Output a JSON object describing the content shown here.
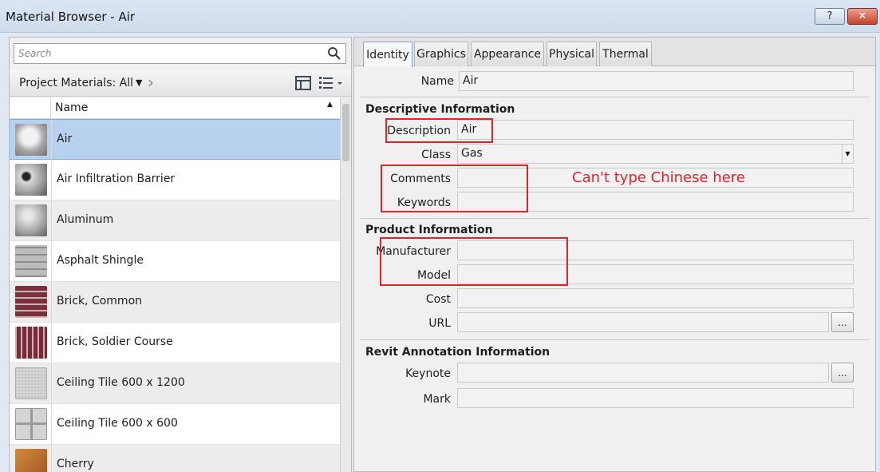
{
  "window": {
    "title": "Material Browser - Air",
    "help_label": "?",
    "close_label": "✕"
  },
  "left_panel": {
    "search_placeholder": "Search",
    "filter_label": "Project Materials: All",
    "column_header": "Name",
    "materials": [
      {
        "name": "Air",
        "selected": true
      },
      {
        "name": "Air Infiltration Barrier"
      },
      {
        "name": "Aluminum"
      },
      {
        "name": "Asphalt Shingle"
      },
      {
        "name": "Brick, Common"
      },
      {
        "name": "Brick, Soldier Course"
      },
      {
        "name": "Ceiling Tile 600 x 1200"
      },
      {
        "name": "Ceiling Tile 600 x 600"
      },
      {
        "name": "Cherry"
      }
    ]
  },
  "tabs": [
    "Identity",
    "Graphics",
    "Appearance",
    "Physical",
    "Thermal"
  ],
  "identity": {
    "name_label": "Name",
    "name_value": "Air",
    "descriptive_header": "Descriptive Information",
    "description_label": "Description",
    "description_value": "Air",
    "class_label": "Class",
    "class_value": "Gas",
    "comments_label": "Comments",
    "comments_value": "",
    "keywords_label": "Keywords",
    "keywords_value": "",
    "product_header": "Product Information",
    "manufacturer_label": "Manufacturer",
    "manufacturer_value": "",
    "model_label": "Model",
    "model_value": "",
    "cost_label": "Cost",
    "cost_value": "",
    "url_label": "URL",
    "url_value": "",
    "revit_header": "Revit Annotation Information",
    "keynote_label": "Keynote",
    "keynote_value": "",
    "mark_label": "Mark",
    "mark_value": "",
    "browse_label": "..."
  },
  "annotation_text": "Can't type Chinese here"
}
